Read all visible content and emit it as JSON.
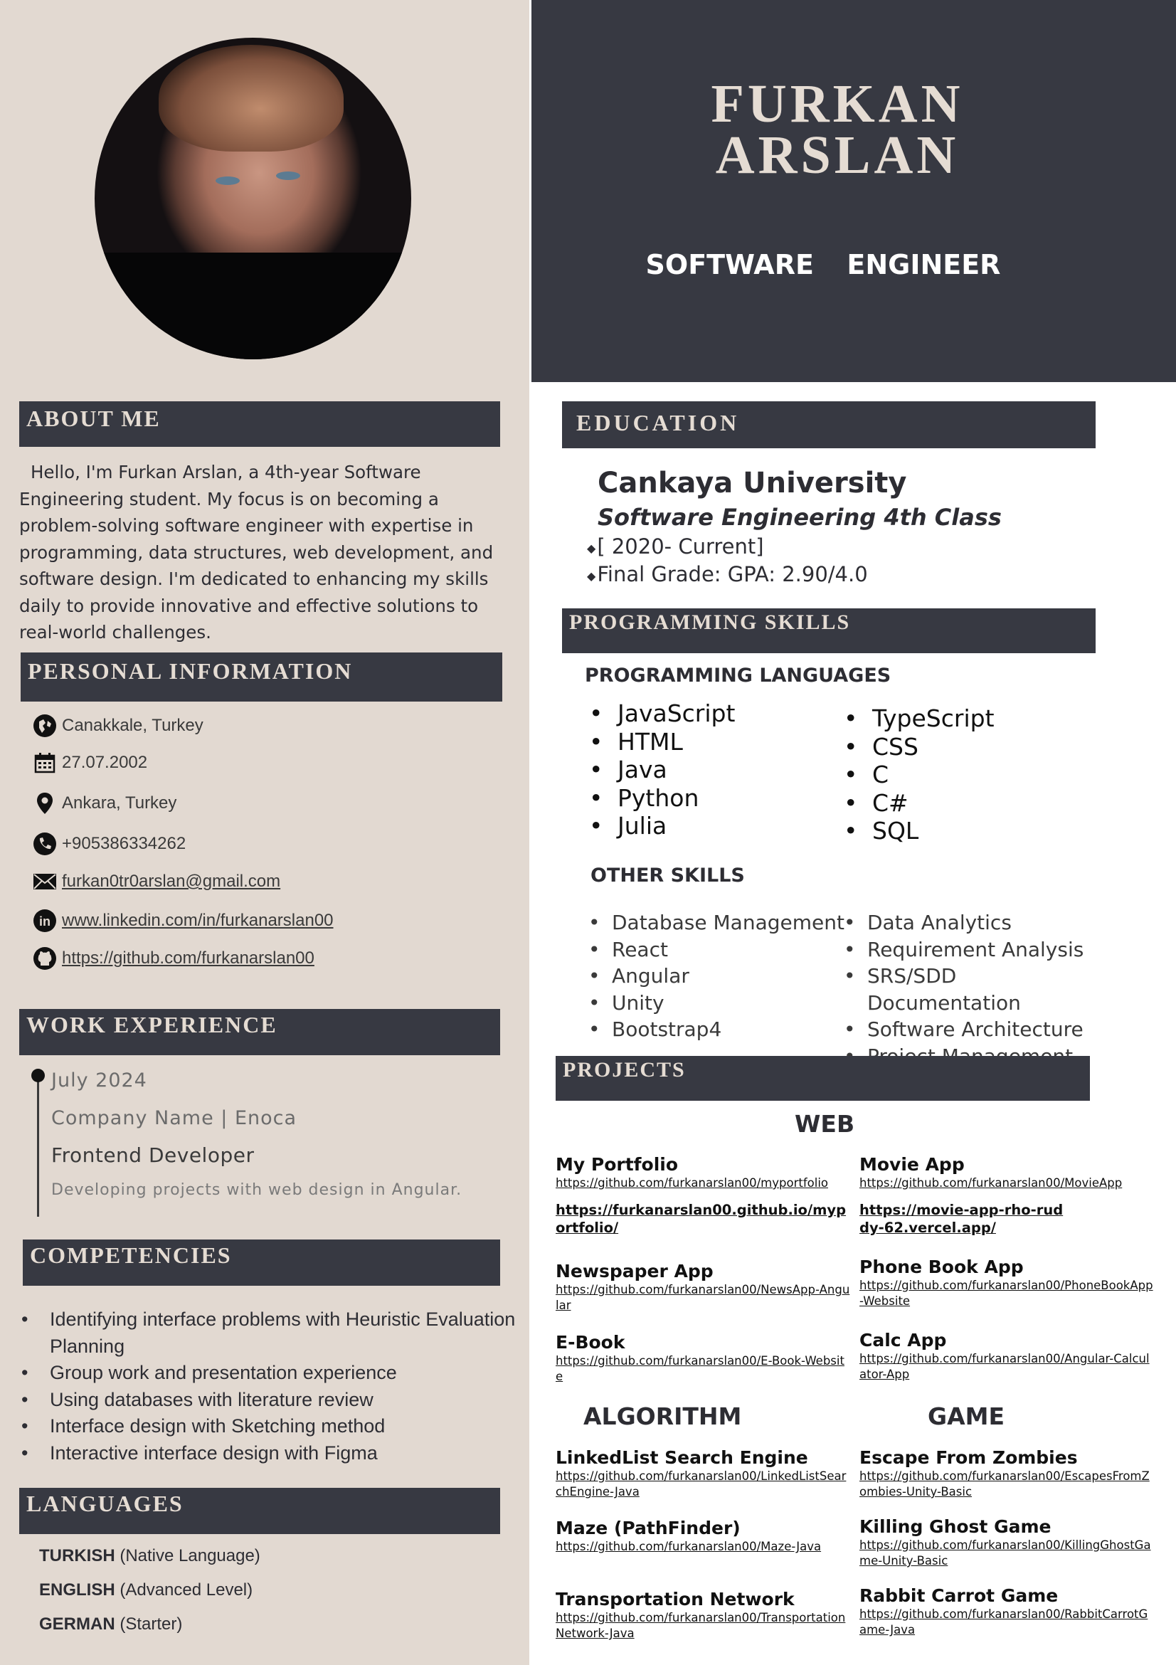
{
  "header": {
    "first_name": "FURKAN",
    "last_name": "ARSLAN",
    "title": "SOFTWARE  ENGINEER"
  },
  "about": {
    "heading": "ABOUT ME",
    "text": "Hello, I'm Furkan Arslan, a 4th-year Software Engineering student. My focus is on becoming a problem-solving software engineer with expertise in programming, data structures, web development, and software design. I'm dedicated to enhancing my skills daily to provide innovative and effective solutions to real-world challenges."
  },
  "personal": {
    "heading": "PERSONAL INFORMATION",
    "birthplace": "Canakkale, Turkey",
    "birthdate": "27.07.2002",
    "location": "Ankara, Turkey",
    "phone": "+905386334262",
    "email": "furkan0tr0arslan@gmail.com",
    "linkedin": "www.linkedin.com/in/furkanarslan00",
    "github": "https://github.com/furkanarslan00"
  },
  "work": {
    "heading": "WORK EXPERIENCE",
    "date": "July 2024",
    "company": "Company Name | Enoca",
    "role": "Frontend Developer",
    "description": "Developing projects with web design in Angular."
  },
  "competencies": {
    "heading": "COMPETENCIES",
    "items": [
      "Identifying interface problems with Heuristic Evaluation Planning",
      "Group work and presentation experience",
      "Using databases with literature review",
      "Interface design with Sketching method",
      "Interactive interface design with Figma"
    ]
  },
  "languages": {
    "heading": "LANGUAGES",
    "items": [
      {
        "name": "TURKISH",
        "level": " (Native Language)"
      },
      {
        "name": "ENGLISH",
        "level": " (Advanced Level)"
      },
      {
        "name": "GERMAN",
        "level": " (Starter)"
      }
    ]
  },
  "education": {
    "heading": "EDUCATION",
    "university": "Cankaya University",
    "program": "Software Engineering 4th Class",
    "period": "[ 2020- Current]",
    "grade": "Final Grade: GPA: 2.90/4.0"
  },
  "skills": {
    "heading": "PROGRAMMING SKILLS",
    "languages_title": "PROGRAMMING LANGUAGES",
    "languages_col1": [
      "JavaScript",
      "HTML",
      "Java",
      "Python",
      "Julia"
    ],
    "languages_col2": [
      "TypeScript",
      "CSS",
      "C",
      "C#",
      "SQL"
    ],
    "other_title": "OTHER SKILLS",
    "other_col1": [
      "Database Management",
      "React",
      "Angular",
      "Unity",
      "Bootstrap4"
    ],
    "other_col2": [
      "Data Analytics",
      "Requirement Analysis",
      "SRS/SDD Documentation",
      "Software Architecture",
      "Project Management"
    ]
  },
  "projects": {
    "heading": "PROJECTS",
    "web_title": "WEB",
    "algorithm_title": "ALGORITHM",
    "game_title": "GAME",
    "web": [
      {
        "title": "My Portfolio",
        "url": "https://github.com/furkanarslan00/myportfolio",
        "url2": "https://furkanarslan00.github.io/myportfolio/"
      },
      {
        "title": "Movie App",
        "url": "https://github.com/furkanarslan00/MovieApp",
        "url2": "https://movie-app-rho-ruddy-62.vercel.app/"
      },
      {
        "title": "Newspaper App",
        "url": "https://github.com/furkanarslan00/NewsApp-Angular"
      },
      {
        "title": "Phone Book App",
        "url": "https://github.com/furkanarslan00/PhoneBookApp-Website"
      },
      {
        "title": "E-Book",
        "url": "https://github.com/furkanarslan00/E-Book-Website"
      },
      {
        "title": "Calc App",
        "url": "https://github.com/furkanarslan00/Angular-Calculator-App"
      }
    ],
    "algorithm": [
      {
        "title": "LinkedList Search Engine",
        "url": "https://github.com/furkanarslan00/LinkedListSearchEngine-Java"
      },
      {
        "title": "Maze (PathFinder)",
        "url": "https://github.com/furkanarslan00/Maze-Java"
      },
      {
        "title": "Transportation Network",
        "url": "https://github.com/furkanarslan00/TransportationNetwork-Java"
      }
    ],
    "game": [
      {
        "title": "Escape From Zombies",
        "url": "https://github.com/furkanarslan00/EscapesFromZombies-Unity-Basic"
      },
      {
        "title": "Killing Ghost Game",
        "url": "https://github.com/furkanarslan00/KillingGhostGame-Unity-Basic"
      },
      {
        "title": "Rabbit Carrot Game",
        "url": "https://github.com/furkanarslan00/RabbitCarrotGame-Java"
      }
    ]
  }
}
